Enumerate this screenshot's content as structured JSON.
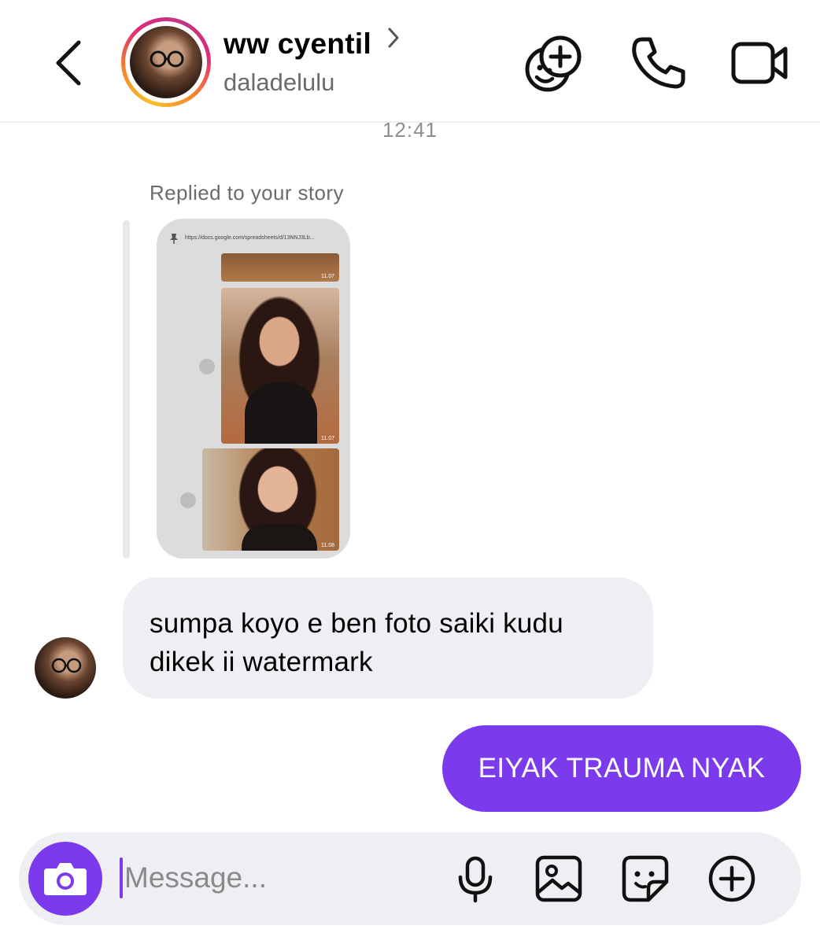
{
  "header": {
    "contact_name": "ww cyentil",
    "username": "daladelulu",
    "icons": {
      "back": "chevron-left-icon",
      "effects": "add-effects-icon",
      "voice_call": "phone-icon",
      "video_call": "video-camera-icon"
    }
  },
  "chat": {
    "timestamp": "12:41",
    "reply_label": "Replied to your story",
    "story": {
      "url": "https://docs.google.com/spreadsheets/d/13NNJ3Lb...",
      "photo_times": [
        "11.07",
        "11.07",
        "11.08"
      ]
    },
    "messages": [
      {
        "direction": "incoming",
        "text": "sumpa koyo e ben foto saiki kudu dikek ii watermark"
      },
      {
        "direction": "outgoing",
        "text": "EIYAK TRAUMA NYAK"
      }
    ]
  },
  "composer": {
    "placeholder": "Message...",
    "value": "",
    "icons": {
      "camera": "camera-icon",
      "voice": "microphone-icon",
      "gallery": "gallery-icon",
      "sticker": "sticker-icon",
      "more": "plus-circle-icon"
    }
  },
  "colors": {
    "accent": "#7c3aed",
    "incoming_bubble": "#efeff3",
    "muted_text": "#6b6b6b"
  }
}
